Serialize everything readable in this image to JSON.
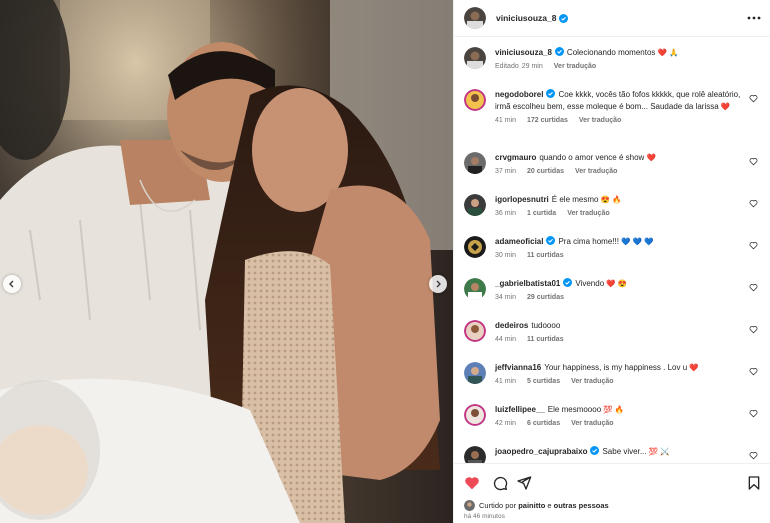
{
  "post": {
    "author": "viniciusouza_8",
    "caption": "Colecionando momentos",
    "caption_emojis": "❤️ 🙏",
    "caption_edited": "Editado",
    "caption_time": "29 min",
    "caption_translate": "Ver tradução"
  },
  "comments": [
    {
      "user": "negodoborel",
      "verified": true,
      "text": "Coe kkkk, vocês tão fofos kkkkk, que rolê aleatório, irmã escolheu bem, esse moleque é bom... Saudade da larissa",
      "emoji": "❤️",
      "time": "41 min",
      "likes": "172 curtidas",
      "translate": "Ver tradução"
    },
    {
      "user": "crvgmauro",
      "verified": false,
      "text": "quando o amor vence é show",
      "emoji": "❤️",
      "time": "37 min",
      "likes": "20 curtidas",
      "translate": "Ver tradução"
    },
    {
      "user": "igorlopesnutri",
      "verified": false,
      "text": "É ele mesmo",
      "emoji": "😍 🔥",
      "time": "36 min",
      "likes": "1 curtida",
      "translate": "Ver tradução"
    },
    {
      "user": "adameoficial",
      "verified": true,
      "text": "Pra cima home!!!",
      "emoji": "💙 💙 💙",
      "time": "30 min",
      "likes": "11 curtidas",
      "translate": ""
    },
    {
      "user": "_gabrielbatista01",
      "verified": true,
      "text": "Vivendo",
      "emoji": "❤️ 😍",
      "time": "34 min",
      "likes": "29 curtidas",
      "translate": ""
    },
    {
      "user": "dedeiros",
      "verified": false,
      "text": "tudoooo",
      "emoji": "",
      "time": "44 min",
      "likes": "11 curtidas",
      "translate": ""
    },
    {
      "user": "jeffvianna16",
      "verified": false,
      "text": "Your happiness, is my happiness . Lov u",
      "emoji": "❤️",
      "time": "41 min",
      "likes": "5 curtidas",
      "translate": "Ver tradução"
    },
    {
      "user": "luizfellipee__",
      "verified": false,
      "text": "Ele mesmoooo",
      "emoji": "💯 🔥",
      "time": "42 min",
      "likes": "6 curtidas",
      "translate": "Ver tradução"
    },
    {
      "user": "joaopedro_cajuprabaixo",
      "verified": true,
      "text": "Sabe viver...",
      "emoji": "💯 ⚔️",
      "time": "",
      "likes": "",
      "translate": ""
    }
  ],
  "footer": {
    "liked_prefix": "Curtido por",
    "liked_user": "painitto",
    "liked_suffix": "e",
    "liked_others": "outras pessoas",
    "time_ago": "há 46 minutos"
  },
  "colors": {
    "accent_red": "#ed4956",
    "verified_blue": "#0095f6",
    "text": "#262626",
    "muted": "#737373"
  },
  "icons": [
    "more-icon",
    "verified-icon",
    "heart-icon",
    "comment-icon",
    "share-icon",
    "bookmark-icon",
    "chevron-left-icon",
    "chevron-right-icon"
  ]
}
